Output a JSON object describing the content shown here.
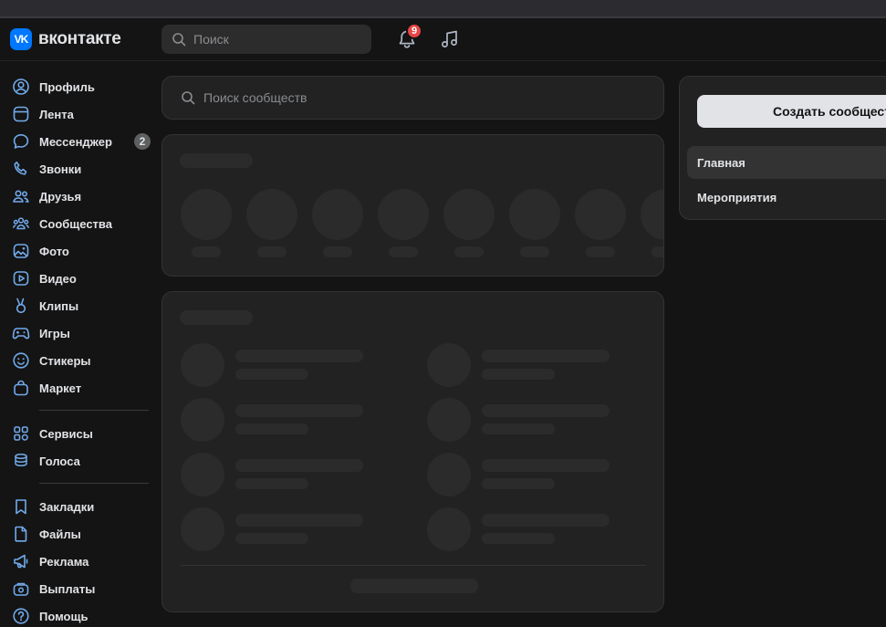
{
  "header": {
    "logo_badge": "VK",
    "logo_text": "вконтакте",
    "search_placeholder": "Поиск",
    "notifications_count": "9"
  },
  "sidebar": {
    "items": [
      {
        "label": "Профиль",
        "icon": "user-circle-icon"
      },
      {
        "label": "Лента",
        "icon": "newsfeed-icon"
      },
      {
        "label": "Мессенджер",
        "icon": "message-icon",
        "count": "2"
      },
      {
        "label": "Звонки",
        "icon": "phone-icon"
      },
      {
        "label": "Друзья",
        "icon": "friends-icon"
      },
      {
        "label": "Сообщества",
        "icon": "communities-icon"
      },
      {
        "label": "Фото",
        "icon": "photo-icon"
      },
      {
        "label": "Видео",
        "icon": "video-icon"
      },
      {
        "label": "Клипы",
        "icon": "clips-icon"
      },
      {
        "label": "Игры",
        "icon": "gamepad-icon"
      },
      {
        "label": "Стикеры",
        "icon": "smile-icon"
      },
      {
        "label": "Маркет",
        "icon": "market-bag-icon"
      },
      {
        "label": "Сервисы",
        "icon": "services-grid-icon"
      },
      {
        "label": "Голоса",
        "icon": "coins-icon"
      },
      {
        "label": "Закладки",
        "icon": "bookmark-icon"
      },
      {
        "label": "Файлы",
        "icon": "file-icon"
      },
      {
        "label": "Реклама",
        "icon": "megaphone-icon"
      },
      {
        "label": "Выплаты",
        "icon": "payouts-icon"
      },
      {
        "label": "Помощь",
        "icon": "help-icon"
      }
    ]
  },
  "main": {
    "search_placeholder": "Поиск сообществ"
  },
  "right_panel": {
    "create_label": "Создать сообщество",
    "menu": [
      {
        "label": "Главная",
        "active": true
      },
      {
        "label": "Мероприятия",
        "active": false
      }
    ]
  },
  "colors": {
    "background": "#141414",
    "card": "#222222",
    "accent": "#0077ff",
    "badge_red": "#e64646",
    "text": "#e1e3e6",
    "muted": "#8a8c90"
  }
}
